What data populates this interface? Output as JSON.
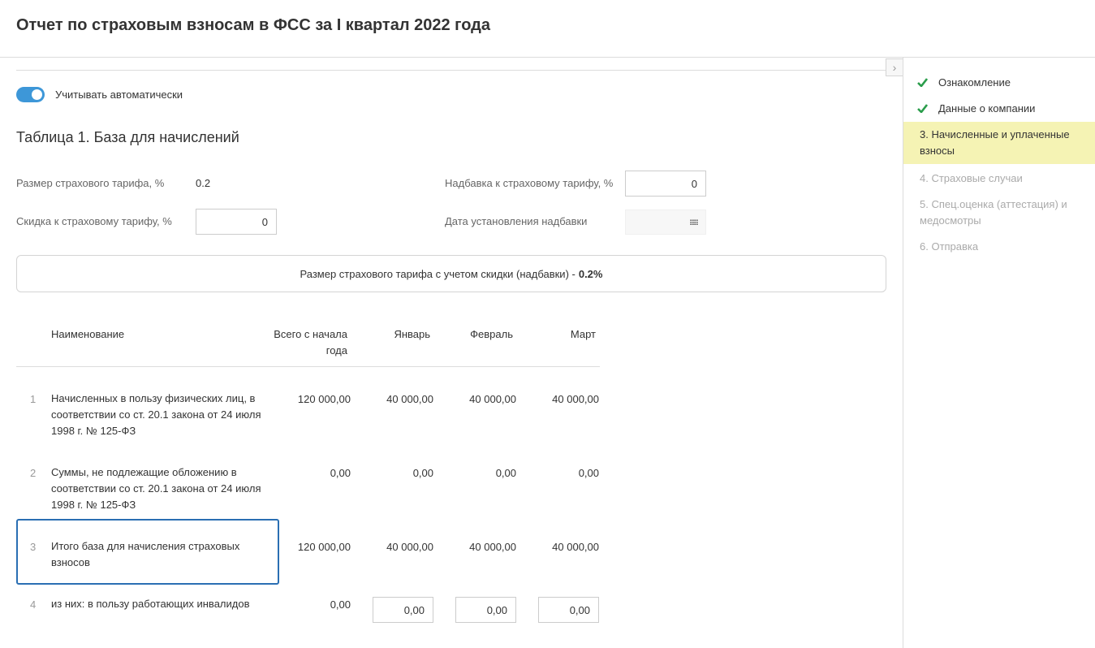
{
  "page_title": "Отчет по страховым взносам в ФСС за I квартал 2022 года",
  "toggle": {
    "label": "Учитывать автоматически",
    "on": true
  },
  "section_title": "Таблица 1. База для начислений",
  "fields": {
    "tariff_label": "Размер страхового тарифа, %",
    "tariff_value": "0.2",
    "discount_label": "Скидка к страховому тарифу, %",
    "discount_value": "0",
    "surcharge_label": "Надбавка к страховому тарифу, %",
    "surcharge_value": "0",
    "surcharge_date_label": "Дата установления надбавки",
    "surcharge_date_value": ""
  },
  "info": {
    "text": "Размер страхового тарифа с учетом скидки (надбавки) -",
    "value": "0.2%"
  },
  "table": {
    "headers": {
      "name": "Наименование",
      "total": "Всего с начала года",
      "jan": "Январь",
      "feb": "Февраль",
      "mar": "Март"
    },
    "rows": [
      {
        "num": "1",
        "name": "Начисленных в пользу физических лиц, в соответствии со ст. 20.1 закона от 24 июля 1998 г. № 125-ФЗ",
        "total": "120 000,00",
        "jan": "40 000,00",
        "feb": "40 000,00",
        "mar": "40 000,00"
      },
      {
        "num": "2",
        "name": "Суммы, не подлежащие обложению в соответствии со ст. 20.1 закона от 24 июля 1998 г. № 125-ФЗ",
        "total": "0,00",
        "jan": "0,00",
        "feb": "0,00",
        "mar": "0,00"
      },
      {
        "num": "3",
        "name": "Итого база для начисления страховых взносов",
        "total": "120 000,00",
        "jan": "40 000,00",
        "feb": "40 000,00",
        "mar": "40 000,00"
      },
      {
        "num": "4",
        "name": "из них: в пользу работающих инвалидов",
        "total": "0,00",
        "jan": "0,00",
        "feb": "0,00",
        "mar": "0,00"
      }
    ]
  },
  "steps": [
    {
      "label": "Ознакомление",
      "state": "done"
    },
    {
      "label": "Данные о компании",
      "state": "done"
    },
    {
      "label": "3.  Начисленные и уплаченные взносы",
      "state": "active"
    },
    {
      "label": "4.  Страховые случаи",
      "state": "todo"
    },
    {
      "label": "5.  Спец.оценка (аттестация) и медосмотры",
      "state": "todo"
    },
    {
      "label": "6.  Отправка",
      "state": "todo"
    }
  ],
  "colors": {
    "accent": "#3d97d8",
    "active_step": "#f5f3b4",
    "check": "#2a9d4b",
    "selection": "#2a6fb3"
  },
  "icons": {
    "collapse": "chevron-right-icon",
    "date": "calendar-icon",
    "done": "check-icon"
  }
}
